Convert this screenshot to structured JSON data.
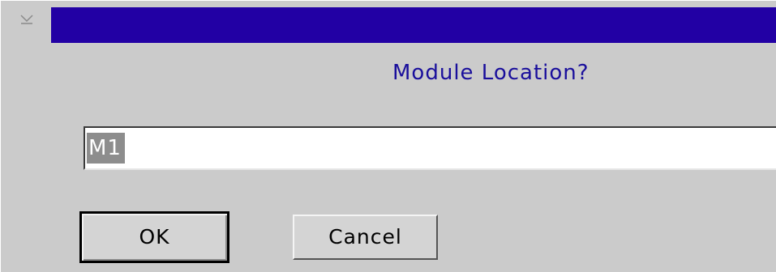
{
  "dialog": {
    "prompt": "Module Location?",
    "input": {
      "value": "M1"
    },
    "buttons": {
      "ok_label": "OK",
      "cancel_label": "Cancel"
    }
  },
  "icons": {
    "system_menu": "system-menu-icon"
  },
  "colors": {
    "titlebar": "#2200a4",
    "prompt_text": "#1a0f9c",
    "dialog_background": "#cbcbcb",
    "selection_background": "#8d8d8d"
  }
}
